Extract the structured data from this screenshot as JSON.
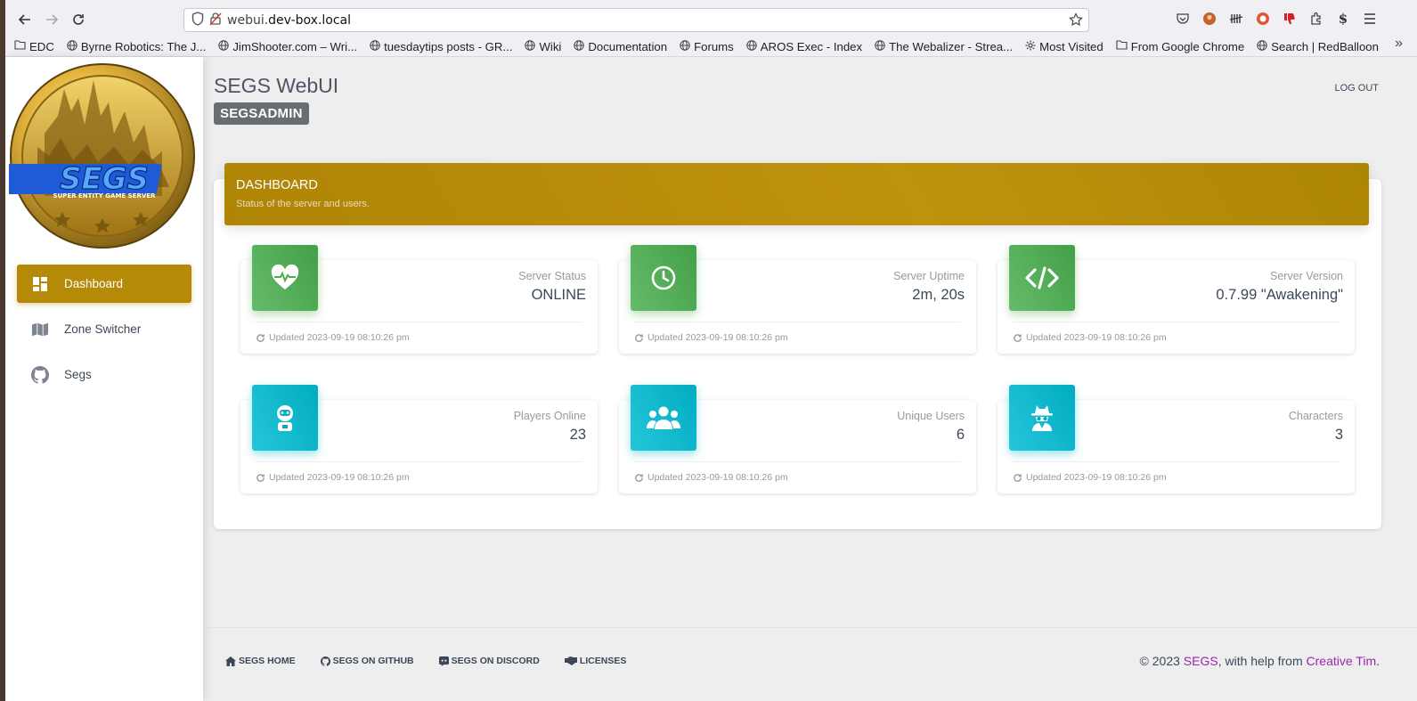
{
  "browser": {
    "url_host_prefix": "webui.",
    "url_domain": "dev-box.local",
    "bookmarks": [
      {
        "label": "EDC",
        "icon": "folder-icon"
      },
      {
        "label": "Byrne Robotics: The J...",
        "icon": "globe-icon"
      },
      {
        "label": "JimShooter.com – Wri...",
        "icon": "globe-icon"
      },
      {
        "label": "tuesdaytips posts - GR...",
        "icon": "globe-icon"
      },
      {
        "label": "Wiki",
        "icon": "globe-icon"
      },
      {
        "label": "Documentation",
        "icon": "globe-icon"
      },
      {
        "label": "Forums",
        "icon": "globe-icon"
      },
      {
        "label": "AROS Exec - Index",
        "icon": "globe-icon"
      },
      {
        "label": "The Webalizer - Strea...",
        "icon": "globe-icon"
      },
      {
        "label": "Most Visited",
        "icon": "gear-icon"
      },
      {
        "label": "From Google Chrome",
        "icon": "folder-icon"
      },
      {
        "label": "Search | RedBalloon",
        "icon": "globe-icon"
      }
    ]
  },
  "app": {
    "title": "SEGS WebUI",
    "user": "SEGSADMIN",
    "logout": "LOG OUT",
    "logo_text": "SEGS",
    "logo_subtext": "SUPER ENTITY GAME SERVER"
  },
  "nav": {
    "items": [
      {
        "label": "Dashboard",
        "icon": "dashboard-icon",
        "active": true
      },
      {
        "label": "Zone Switcher",
        "icon": "map-icon",
        "active": false
      },
      {
        "label": "Segs",
        "icon": "github-icon",
        "active": false
      }
    ]
  },
  "dashboard": {
    "title": "DASHBOARD",
    "subtitle": "Status of the server and users.",
    "accent": "#b48a08",
    "stats": [
      {
        "label": "Server Status",
        "value": "ONLINE",
        "updated": "Updated 2023-09-19 08:10:26 pm",
        "icon": "heartbeat-icon",
        "color": "#4caf50"
      },
      {
        "label": "Server Uptime",
        "value": "2m, 20s",
        "updated": "Updated 2023-09-19 08:10:26 pm",
        "icon": "clock-icon",
        "color": "#4caf50"
      },
      {
        "label": "Server Version",
        "value": "0.7.99 \"Awakening\"",
        "updated": "Updated 2023-09-19 08:10:26 pm",
        "icon": "code-icon",
        "color": "#4caf50"
      },
      {
        "label": "Players Online",
        "value": "23",
        "updated": "Updated 2023-09-19 08:10:26 pm",
        "icon": "robot-icon",
        "color": "#00bcd4"
      },
      {
        "label": "Unique Users",
        "value": "6",
        "updated": "Updated 2023-09-19 08:10:26 pm",
        "icon": "users-icon",
        "color": "#00bcd4"
      },
      {
        "label": "Characters",
        "value": "3",
        "updated": "Updated 2023-09-19 08:10:26 pm",
        "icon": "spy-icon",
        "color": "#00bcd4"
      }
    ]
  },
  "footer": {
    "links": [
      {
        "label": "SEGS HOME",
        "icon": "home-icon"
      },
      {
        "label": "SEGS ON GITHUB",
        "icon": "github-icon"
      },
      {
        "label": "SEGS ON DISCORD",
        "icon": "discord-icon"
      },
      {
        "label": "LICENSES",
        "icon": "handshake-icon"
      }
    ],
    "copyright_prefix": "© 2023 ",
    "copyright_brand": "SEGS",
    "copyright_mid": ", with help from ",
    "copyright_credit": "Creative Tim",
    "copyright_end": "."
  }
}
